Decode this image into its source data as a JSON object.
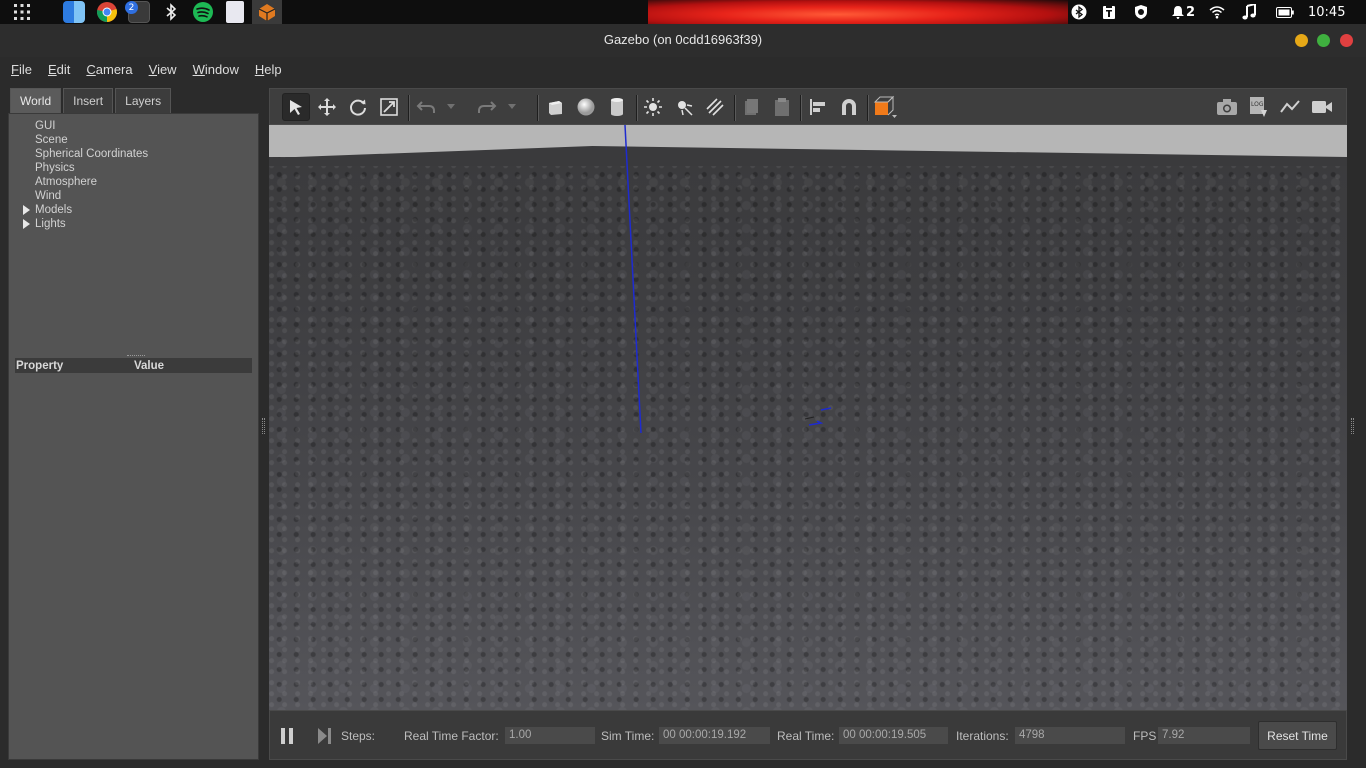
{
  "system_bar": {
    "dock_icons": [
      "apps-grid-icon",
      "finder-icon",
      "chrome-icon",
      "terminal-icon",
      "bluetooth-icon",
      "spotify-icon",
      "document-viewer-icon",
      "gazebo-icon"
    ],
    "terminal_badge": "2",
    "notification_count": "2",
    "clock": "10:45"
  },
  "window": {
    "title": "Gazebo (on 0cdd16963f39)"
  },
  "menubar": {
    "items": [
      {
        "label": "File",
        "mnemonic": "F",
        "rest": "ile"
      },
      {
        "label": "Edit",
        "mnemonic": "E",
        "rest": "dit"
      },
      {
        "label": "Camera",
        "mnemonic": "C",
        "rest": "amera"
      },
      {
        "label": "View",
        "mnemonic": "V",
        "rest": "iew"
      },
      {
        "label": "Window",
        "mnemonic": "W",
        "rest": "indow"
      },
      {
        "label": "Help",
        "mnemonic": "H",
        "rest": "elp"
      }
    ]
  },
  "left_panel": {
    "tabs": [
      "World",
      "Insert",
      "Layers"
    ],
    "active_tab": "World",
    "tree": [
      "GUI",
      "Scene",
      "Spherical Coordinates",
      "Physics",
      "Atmosphere",
      "Wind",
      "Models",
      "Lights"
    ],
    "property_header": "Property",
    "value_header": "Value"
  },
  "bottom_bar": {
    "steps_label": "Steps:",
    "rtf_label": "Real Time Factor:",
    "rtf_value": "1.00",
    "sim_time_label": "Sim Time:",
    "sim_time_value": "00 00:00:19.192",
    "real_time_label": "Real Time:",
    "real_time_value": "00 00:00:19.505",
    "iterations_label": "Iterations:",
    "iterations_value": "4798",
    "fps_label": "FPS:",
    "fps_value": "7.92",
    "reset_label": "Reset Time"
  },
  "colors": {
    "window_close": "#e04040",
    "window_minimize": "#e6a817",
    "window_maximize": "#3fb03f",
    "axis_blue": "#1e2bd0",
    "box_orange": "#f07a1a"
  }
}
